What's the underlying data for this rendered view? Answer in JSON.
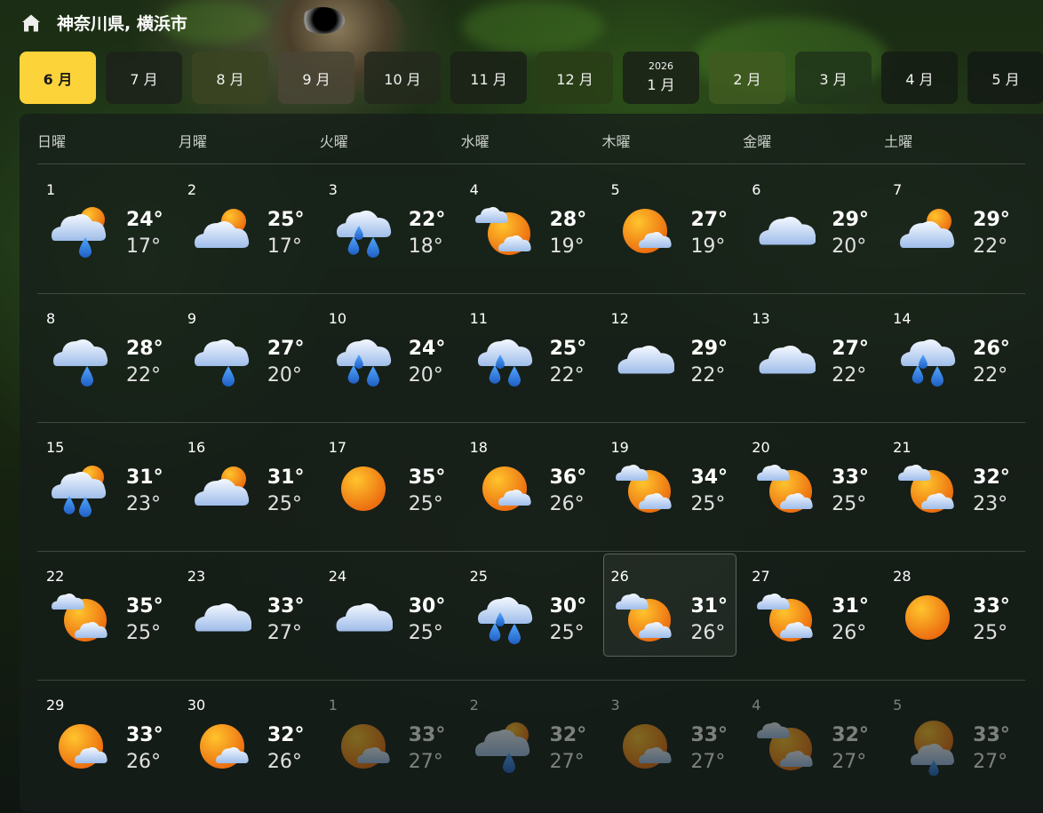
{
  "header": {
    "location": "神奈川県, 横浜市"
  },
  "months": [
    {
      "label": "6 月",
      "year": "",
      "active": true
    },
    {
      "label": "7 月",
      "year": ""
    },
    {
      "label": "8 月",
      "year": ""
    },
    {
      "label": "9 月",
      "year": ""
    },
    {
      "label": "10 月",
      "year": ""
    },
    {
      "label": "11 月",
      "year": ""
    },
    {
      "label": "12 月",
      "year": ""
    },
    {
      "label": "1 月",
      "year": "2026"
    },
    {
      "label": "2 月",
      "year": ""
    },
    {
      "label": "3 月",
      "year": ""
    },
    {
      "label": "4 月",
      "year": ""
    },
    {
      "label": "5 月",
      "year": ""
    }
  ],
  "weekdays": [
    "日曜",
    "月曜",
    "火曜",
    "水曜",
    "木曜",
    "金曜",
    "土曜"
  ],
  "colors": {
    "accent": "#fdd33a",
    "sun": "#f39a1c",
    "cloud": "#cfe0f7",
    "rain": "#2f7fe0"
  },
  "days": [
    {
      "day": "1",
      "icon": "rain-cloud-sun-icon",
      "high": "24°",
      "low": "17°"
    },
    {
      "day": "2",
      "icon": "cloud-sun-icon",
      "high": "25°",
      "low": "17°"
    },
    {
      "day": "3",
      "icon": "heavy-rain-icon",
      "high": "22°",
      "low": "18°"
    },
    {
      "day": "4",
      "icon": "sun-clouds-icon",
      "high": "28°",
      "low": "19°"
    },
    {
      "day": "5",
      "icon": "sun-small-cloud-icon",
      "high": "27°",
      "low": "19°"
    },
    {
      "day": "6",
      "icon": "cloud-icon",
      "high": "29°",
      "low": "20°"
    },
    {
      "day": "7",
      "icon": "cloud-sun-icon",
      "high": "29°",
      "low": "22°"
    },
    {
      "day": "8",
      "icon": "rain-cloud-icon",
      "high": "28°",
      "low": "22°"
    },
    {
      "day": "9",
      "icon": "rain-cloud-icon",
      "high": "27°",
      "low": "20°"
    },
    {
      "day": "10",
      "icon": "heavy-rain-icon",
      "high": "24°",
      "low": "20°"
    },
    {
      "day": "11",
      "icon": "heavy-rain-icon",
      "high": "25°",
      "low": "22°"
    },
    {
      "day": "12",
      "icon": "cloud-icon",
      "high": "29°",
      "low": "22°"
    },
    {
      "day": "13",
      "icon": "cloud-icon",
      "high": "27°",
      "low": "22°"
    },
    {
      "day": "14",
      "icon": "heavy-rain-icon",
      "high": "26°",
      "low": "22°"
    },
    {
      "day": "15",
      "icon": "heavy-rain-sun-icon",
      "high": "31°",
      "low": "23°"
    },
    {
      "day": "16",
      "icon": "cloud-sun-icon",
      "high": "31°",
      "low": "25°"
    },
    {
      "day": "17",
      "icon": "sun-icon",
      "high": "35°",
      "low": "25°"
    },
    {
      "day": "18",
      "icon": "sun-small-cloud-icon",
      "high": "36°",
      "low": "26°"
    },
    {
      "day": "19",
      "icon": "sun-clouds-icon",
      "high": "34°",
      "low": "25°"
    },
    {
      "day": "20",
      "icon": "sun-clouds-icon",
      "high": "33°",
      "low": "25°"
    },
    {
      "day": "21",
      "icon": "sun-clouds-icon",
      "high": "32°",
      "low": "23°"
    },
    {
      "day": "22",
      "icon": "sun-clouds-icon",
      "high": "35°",
      "low": "25°"
    },
    {
      "day": "23",
      "icon": "cloud-icon",
      "high": "33°",
      "low": "27°"
    },
    {
      "day": "24",
      "icon": "cloud-icon",
      "high": "30°",
      "low": "25°"
    },
    {
      "day": "25",
      "icon": "heavy-rain-icon",
      "high": "30°",
      "low": "25°"
    },
    {
      "day": "26",
      "icon": "sun-clouds-icon",
      "high": "31°",
      "low": "26°",
      "today": true
    },
    {
      "day": "27",
      "icon": "sun-clouds-icon",
      "high": "31°",
      "low": "26°"
    },
    {
      "day": "28",
      "icon": "sun-icon",
      "high": "33°",
      "low": "25°"
    },
    {
      "day": "29",
      "icon": "sun-small-cloud-icon",
      "high": "33°",
      "low": "26°"
    },
    {
      "day": "30",
      "icon": "sun-small-cloud-icon",
      "high": "32°",
      "low": "26°"
    },
    {
      "day": "1",
      "icon": "sun-small-cloud-icon",
      "high": "33°",
      "low": "27°",
      "muted": true
    },
    {
      "day": "2",
      "icon": "rain-cloud-sun-icon",
      "high": "32°",
      "low": "27°",
      "muted": true
    },
    {
      "day": "3",
      "icon": "sun-small-cloud-icon",
      "high": "33°",
      "low": "27°",
      "muted": true
    },
    {
      "day": "4",
      "icon": "sun-clouds-icon",
      "high": "32°",
      "low": "27°",
      "muted": true
    },
    {
      "day": "5",
      "icon": "rain-sun-icon",
      "high": "33°",
      "low": "27°",
      "muted": true
    }
  ]
}
